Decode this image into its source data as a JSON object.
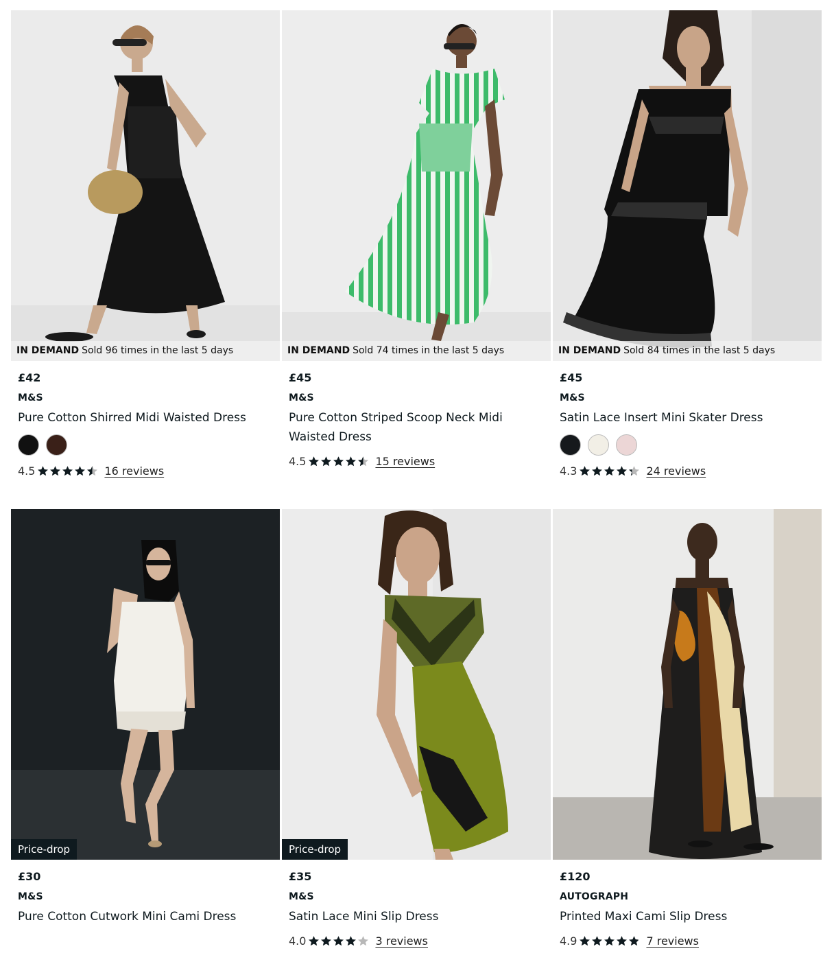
{
  "colors": {
    "ink": "#0f1a1f",
    "star": "#0f1a1f",
    "star_empty": "#b8b8b8"
  },
  "products": [
    {
      "badge": {
        "type": "demand",
        "bold": "IN DEMAND",
        "text": "Sold 96 times in the last 5 days"
      },
      "price": "£42",
      "brand": "M&S",
      "name": "Pure Cotton Shirred Midi Waisted Dress",
      "swatches": [
        "#111111",
        "#3a2018"
      ],
      "rating": "4.5",
      "stars": 4.5,
      "reviews": "16 reviews",
      "image": "woman-black-midi-dress"
    },
    {
      "badge": {
        "type": "demand",
        "bold": "IN DEMAND",
        "text": "Sold 74 times in the last 5 days"
      },
      "price": "£45",
      "brand": "M&S",
      "name": "Pure Cotton Striped Scoop Neck Midi Waisted Dress",
      "swatches": [],
      "rating": "4.5",
      "stars": 4.5,
      "reviews": "15 reviews",
      "image": "woman-green-striped-dress"
    },
    {
      "badge": {
        "type": "demand",
        "bold": "IN DEMAND",
        "text": "Sold 84 times in the last 5 days"
      },
      "price": "£45",
      "brand": "M&S",
      "name": "Satin Lace Insert Mini Skater Dress",
      "swatches": [
        "#16191c",
        "#f2efe6",
        "#ecd6d6"
      ],
      "rating": "4.3",
      "stars": 4.3,
      "reviews": "24 reviews",
      "image": "woman-black-satin-lace-dress"
    },
    {
      "badge": {
        "type": "pricedrop",
        "text": "Price-drop"
      },
      "price": "£30",
      "brand": "M&S",
      "name": "Pure Cotton Cutwork Mini Cami Dress",
      "swatches": [],
      "rating": "",
      "stars": 0,
      "reviews": "",
      "image": "woman-white-cami-dress"
    },
    {
      "badge": {
        "type": "pricedrop",
        "text": "Price-drop"
      },
      "price": "£35",
      "brand": "M&S",
      "name": "Satin Lace Mini Slip Dress",
      "swatches": [],
      "rating": "4.0",
      "stars": 4.0,
      "reviews": "3 reviews",
      "image": "woman-olive-slip-dress"
    },
    {
      "badge": null,
      "price": "£120",
      "brand": "AUTOGRAPH",
      "name": "Printed Maxi Cami Slip Dress",
      "swatches": [],
      "rating": "4.9",
      "stars": 4.9,
      "reviews": "7 reviews",
      "image": "woman-printed-maxi-dress"
    }
  ]
}
